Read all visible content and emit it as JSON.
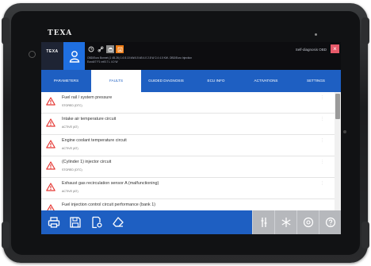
{
  "device": {
    "brand": "TEXA"
  },
  "app": {
    "logo_text": "TEXA",
    "title": "Self-diagnosis OBD",
    "vehicle_info": [
      "OBD/Euro Bonnet (1 4B.26) 1.6 8.10 kW/4.5 kB 4.0 2.8 W 2.4 4.0 KW- OBD/Euro Injection",
      "Euro6/7 F1 vrt/0.7 L 4.0 W"
    ],
    "close_label": "×",
    "colors": {
      "accent": "#1e5fc2",
      "warning": "#e53935",
      "close": "#e75a6a",
      "orange": "#ee7a12"
    }
  },
  "topbar_icons": [
    "clock-icon",
    "link-icon",
    "print-grey-icon",
    "export-orange-icon"
  ],
  "tabs": [
    {
      "label": "PARAMETERS"
    },
    {
      "label": "FAULTS",
      "active": true
    },
    {
      "label": "GUIDED DIAGNOSIS"
    },
    {
      "label": "ECU INFO"
    },
    {
      "label": "ACTIVATIONS"
    },
    {
      "label": "SETTINGS"
    }
  ],
  "faults": [
    {
      "title": "Fuel rail / system pressure",
      "status": "STORED (DTC)"
    },
    {
      "title": "Intake air temperature circuit",
      "status": "ACTIVE (AT)"
    },
    {
      "title": "Engine coolant temperature circuit",
      "status": "ACTIVE (AT)"
    },
    {
      "title": "(Cylinder 1) injector circuit",
      "status": "STORED (DTC)"
    },
    {
      "title": "Exhaust gas recirculation sensor A (malfunctioning)",
      "status": "ACTIVE (AT)"
    },
    {
      "title": "Fuel injection control circuit performance (bank 1)",
      "status": ""
    }
  ],
  "bottom_toolbar": {
    "left_icons": [
      "print-icon",
      "save-icon",
      "document-settings-icon",
      "eraser-icon"
    ],
    "right_icons": [
      "tools-icon",
      "snowflake-icon",
      "help-icon",
      "question-icon"
    ]
  }
}
